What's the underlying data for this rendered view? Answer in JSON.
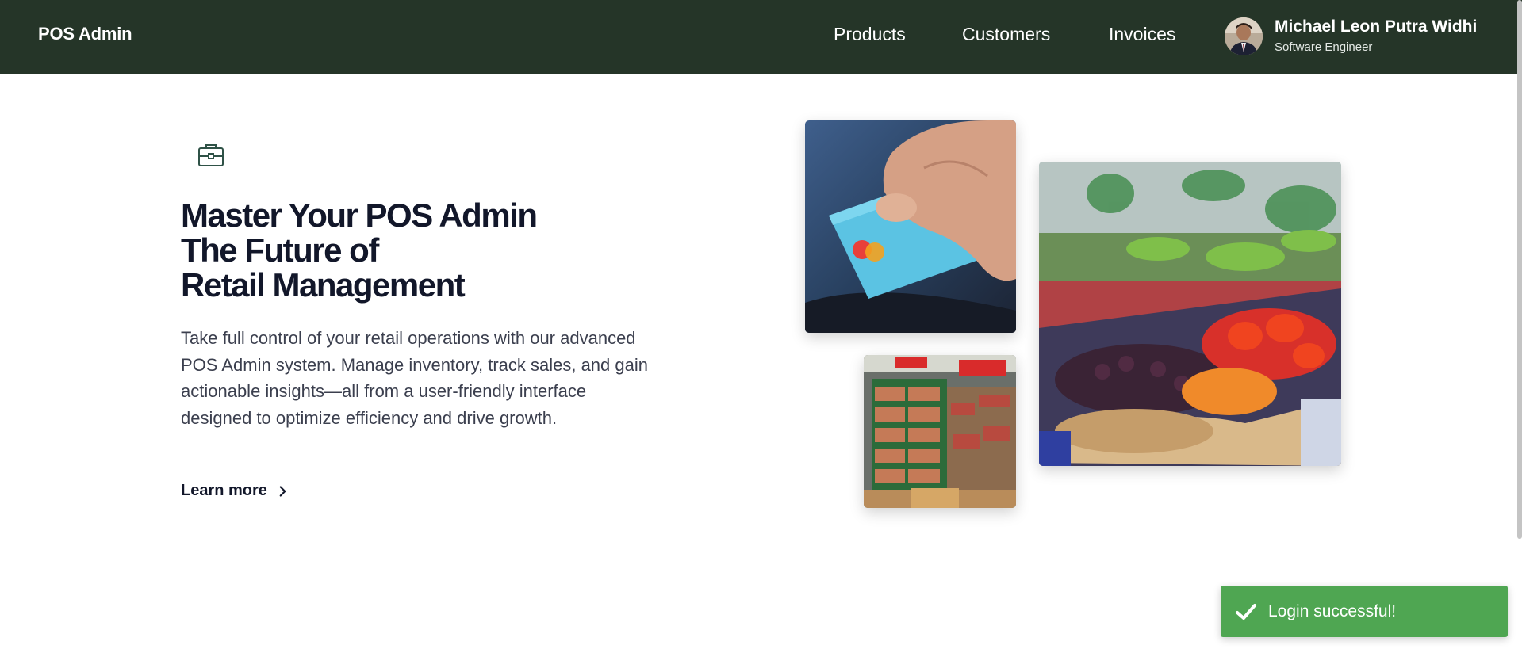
{
  "header": {
    "brand": "POS Admin",
    "nav": [
      {
        "label": "Products",
        "icon": "none"
      },
      {
        "label": "Customers",
        "icon": "none"
      },
      {
        "label": "Invoices",
        "icon": "none"
      }
    ],
    "user": {
      "name": "Michael Leon Putra Widhi",
      "role": "Software Engineer",
      "avatar_icon": "user-avatar-photo"
    },
    "background_color": "#253528"
  },
  "hero": {
    "icon": "briefcase-icon",
    "headline_lines": [
      "Master Your POS Admin",
      "The Future of",
      "Retail Management"
    ],
    "description": "Take full control of your retail operations with our advanced POS Admin system. Manage inventory, track sales, and gain actionable insights—all from a user-friendly interface designed to optimize efficiency and drive growth.",
    "link_label": "Learn more",
    "link_icon": "chevron-right-icon",
    "images": [
      "credit-card-payment-photo",
      "supermarket-aisle-photo",
      "produce-market-photo"
    ]
  },
  "toast": {
    "message": "Login successful!",
    "icon": "checkmark-icon",
    "color": "#4fa652"
  }
}
